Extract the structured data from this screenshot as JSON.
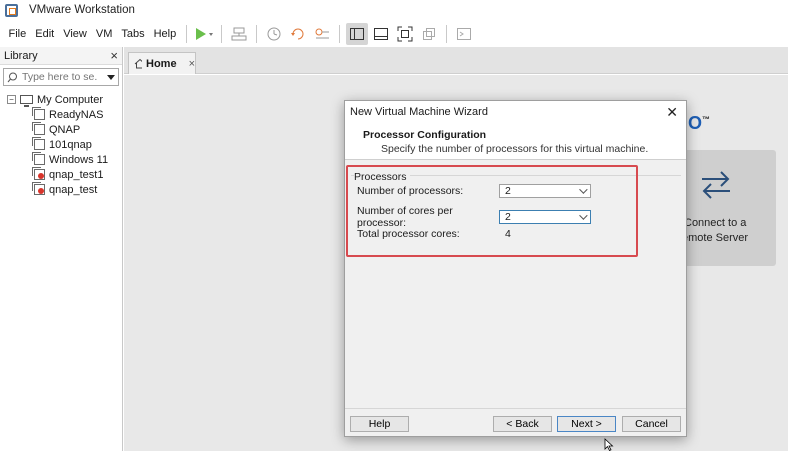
{
  "window": {
    "title": "VMware Workstation"
  },
  "menu": [
    "File",
    "Edit",
    "View",
    "VM",
    "Tabs",
    "Help"
  ],
  "library": {
    "title": "Library",
    "search_placeholder": "Type here to se...",
    "root": "My Computer",
    "items": [
      {
        "label": "ReadyNAS",
        "error": false
      },
      {
        "label": "QNAP",
        "error": false
      },
      {
        "label": "101qnap",
        "error": false
      },
      {
        "label": "Windows 11",
        "error": false
      },
      {
        "label": "qnap_test1",
        "error": true
      },
      {
        "label": "qnap_test",
        "error": true
      }
    ]
  },
  "tabs": [
    {
      "label": "Home"
    }
  ],
  "home": {
    "brand_fragment": "O",
    "brand_tm": "™",
    "tile_label_line1": "Connect to a",
    "tile_label_line2": "emote Server"
  },
  "dialog": {
    "title": "New Virtual Machine Wizard",
    "header_title": "Processor Configuration",
    "header_subtitle": "Specify the number of processors for this virtual machine.",
    "group_label": "Processors",
    "fields": {
      "num_processors_label": "Number of processors:",
      "num_processors_value": "2",
      "cores_label": "Number of cores per processor:",
      "cores_value": "2",
      "total_label": "Total processor cores:",
      "total_value": "4"
    },
    "buttons": {
      "help": "Help",
      "back": "< Back",
      "next": "Next >",
      "cancel": "Cancel"
    }
  },
  "colors": {
    "highlight": "#d74a4f",
    "accent": "#4a86c5",
    "play": "#6abf4b"
  }
}
